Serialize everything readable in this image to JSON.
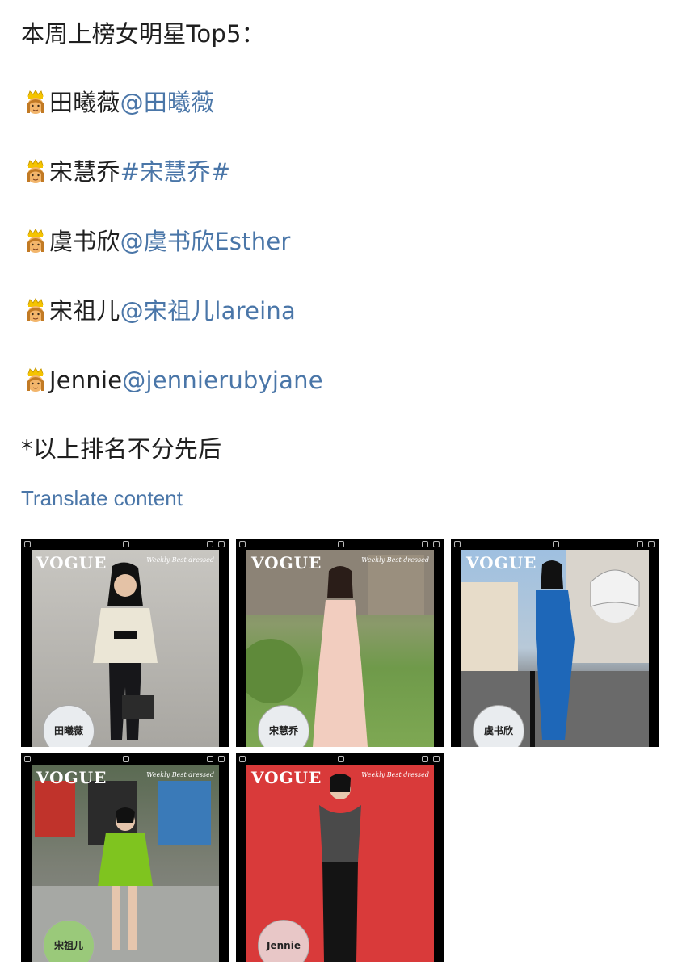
{
  "post": {
    "heading": "本周上榜女明星Top5：",
    "entries": [
      {
        "name": "田曦薇",
        "mention": "@田曦薇"
      },
      {
        "name": "宋慧乔",
        "mention": "#宋慧乔#"
      },
      {
        "name": "虞书欣",
        "mention": "@虞书欣Esther"
      },
      {
        "name": "宋祖儿",
        "mention": "@宋祖儿lareina"
      },
      {
        "name": "Jennie",
        "mention": "@jennierubyjane"
      }
    ],
    "note": "*以上排名不分先后",
    "translate_label": "Translate content"
  },
  "images": [
    {
      "brand": "VOGUE",
      "tagline": "Weekly Best dressed",
      "stamp": "田曦薇",
      "bg": "#b9b7b2"
    },
    {
      "brand": "VOGUE",
      "tagline": "Weekly Best dressed",
      "stamp": "宋慧乔",
      "bg": "#8ea86c"
    },
    {
      "brand": "VOGUE",
      "tagline": "",
      "stamp": "虞书欣",
      "bg": "#9fb8d6"
    },
    {
      "brand": "VOGUE",
      "tagline": "Weekly Best dressed",
      "stamp": "宋祖儿",
      "bg": "#6f7c66"
    },
    {
      "brand": "VOGUE",
      "tagline": "Weekly Best dressed",
      "stamp": "Jennie",
      "bg": "#d93a3a"
    }
  ],
  "colors": {
    "link": "#4a76a8",
    "text": "#1f1f1f"
  },
  "icons": {
    "entry_emoji": "princess-emoji-icon"
  }
}
